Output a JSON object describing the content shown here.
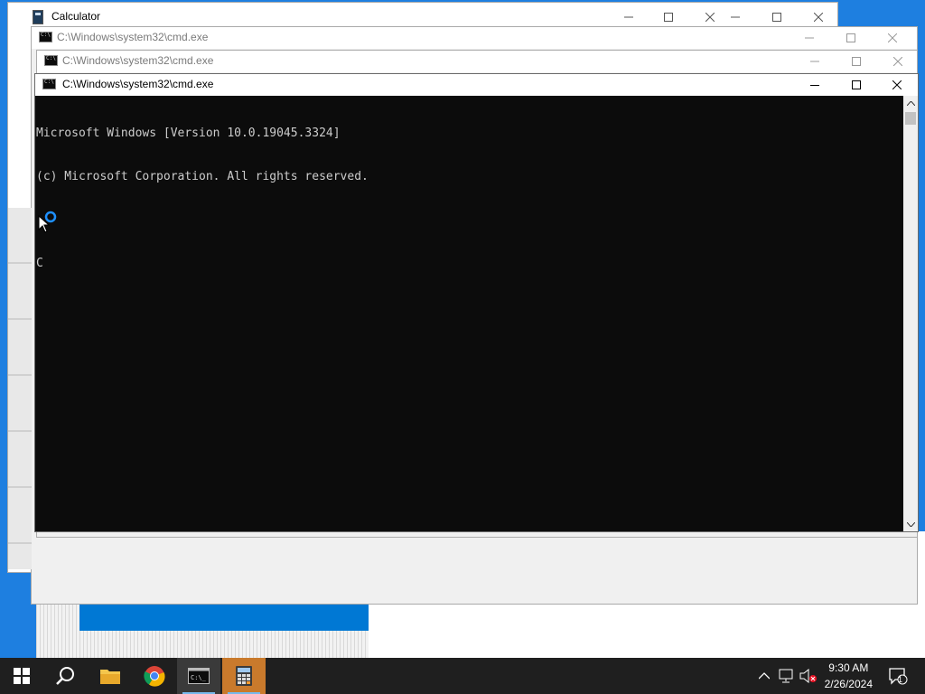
{
  "windows": {
    "calculator": {
      "title": "Calculator"
    },
    "cmd_back": {
      "title": "C:\\Windows\\system32\\cmd.exe"
    },
    "cmd_mid": {
      "title": "C:\\Windows\\system32\\cmd.exe"
    },
    "cmd_front": {
      "title": "C:\\Windows\\system32\\cmd.exe"
    }
  },
  "console": {
    "lines": [
      "Microsoft Windows [Version 10.0.19045.3324]",
      "(c) Microsoft Corporation. All rights reserved.",
      "",
      "C"
    ]
  },
  "taskbar": {
    "items": [
      "start-icon",
      "search-icon",
      "file-explorer-icon",
      "chrome-icon",
      "cmd-icon",
      "calculator-icon"
    ],
    "clock": {
      "time": "9:30 AM",
      "date": "2/26/2024"
    },
    "notification_count": "1"
  },
  "colors": {
    "console_bg": "#0c0c0c",
    "console_fg": "#cccccc",
    "taskbar_bg": "#1f1f1f",
    "accent": "#0078d4"
  }
}
